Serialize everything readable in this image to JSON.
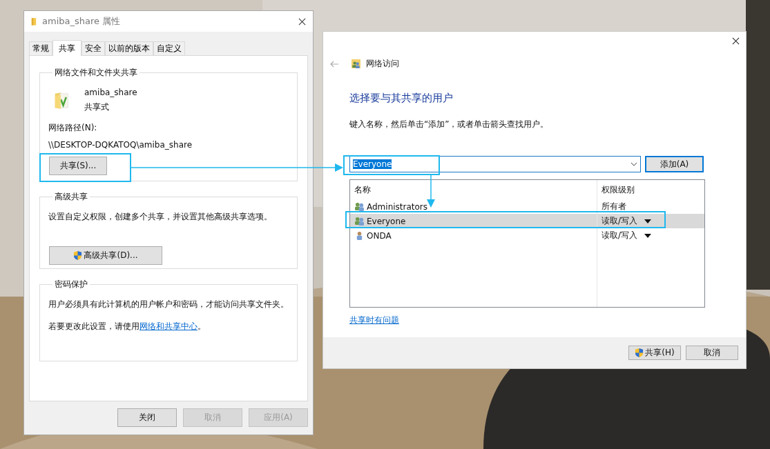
{
  "properties_dialog": {
    "title": "amiba_share 属性",
    "tabs": [
      {
        "label": "常规",
        "selected": false
      },
      {
        "label": "共享",
        "selected": true
      },
      {
        "label": "安全",
        "selected": false
      },
      {
        "label": "以前的版本",
        "selected": false
      },
      {
        "label": "自定义",
        "selected": false
      }
    ],
    "network_sharing": {
      "heading": "网络文件和文件夹共享",
      "name": "amiba_share",
      "status": "共享式",
      "path_label": "网络路径(N):",
      "path": "\\\\DESKTOP-DQKATOQ\\amiba_share",
      "share_button": "共享(S)..."
    },
    "advanced_sharing": {
      "heading": "高级共享",
      "description": "设置自定义权限，创建多个共享，并设置其他高级共享选项。",
      "button": "高级共享(D)..."
    },
    "password_protection": {
      "heading": "密码保护",
      "description": "用户必须具有此计算机的用户帐户和密码，才能访问共享文件夹。",
      "change_prefix": "若要更改此设置，请使用",
      "link": "网络和共享中心",
      "change_suffix": "。"
    },
    "buttons": [
      {
        "label": "关闭",
        "disabled": false
      },
      {
        "label": "取消",
        "disabled": true
      },
      {
        "label": "应用(A)",
        "disabled": true
      }
    ]
  },
  "network_access_dialog": {
    "title": "网络访问",
    "heading": "选择要与其共享的用户",
    "instruction": "键入名称，然后单击“添加”，或者单击箭头查找用户。",
    "user_input": {
      "value": "Everyone",
      "text_selected": true
    },
    "add_button": "添加(A)",
    "table": {
      "columns": [
        "名称",
        "权限级别"
      ],
      "rows": [
        {
          "name": "Administrators",
          "kind": "group",
          "permission": "所有者",
          "has_dropdown": false,
          "selected": false
        },
        {
          "name": "Everyone",
          "kind": "group",
          "permission": "读取/写入",
          "has_dropdown": true,
          "selected": true
        },
        {
          "name": "ONDA",
          "kind": "user",
          "permission": "读取/写入",
          "has_dropdown": true,
          "selected": false
        }
      ]
    },
    "help_link": "共享时有问题",
    "buttons": [
      {
        "label": "共享(H)",
        "shield": true
      },
      {
        "label": "取消",
        "shield": false
      }
    ]
  }
}
